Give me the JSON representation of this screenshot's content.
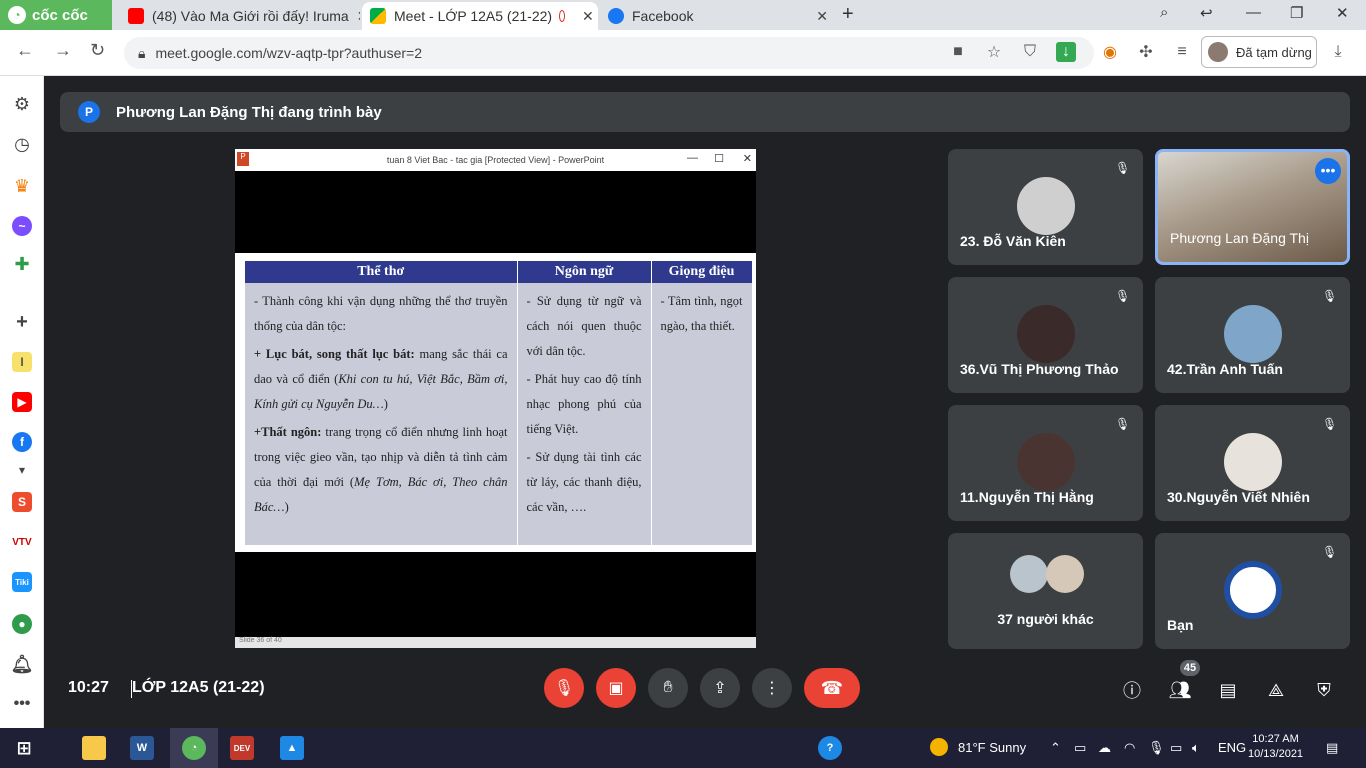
{
  "browser": {
    "brand": "cốc cốc",
    "tabs": [
      {
        "title": "(48) Vào Ma Giới rồi đấy! Iruma"
      },
      {
        "title": "Meet - LỚP 12A5 (21-22)"
      },
      {
        "title": "Facebook"
      }
    ],
    "url": "meet.google.com/wzv-aqtp-tpr?authuser=2",
    "profile_label": "Đã tạm dừng"
  },
  "meet": {
    "presenting_avatar": "P",
    "presenting_text": "Phương Lan Đặng Thị đang trình bày",
    "clock": "10:27",
    "meeting_title": "LỚP 12A5 (21-22)",
    "participant_count": "45",
    "participants": [
      {
        "name": "23. Đỗ Văn Kiên"
      },
      {
        "name": "Phương Lan Đặng Thị"
      },
      {
        "name": "36.Vũ Thị Phương Thảo"
      },
      {
        "name": "42.Trần Anh Tuấn"
      },
      {
        "name": "11.Nguyễn Thị Hằng"
      },
      {
        "name": "30.Nguyễn Viết Nhiên"
      },
      {
        "name": "37 người khác"
      },
      {
        "name": "Bạn"
      }
    ]
  },
  "ppt": {
    "window_title": "tuan 8 Viet Bac - tac gia [Protected View] - PowerPoint",
    "status": "Slide 36 of 40",
    "headers": [
      "Thể thơ",
      "Ngôn ngữ",
      "Giọng điệu"
    ],
    "col1": {
      "p1": "-  Thành công khi vận dụng những thể thơ truyền thống của dân tộc:",
      "p2_bold": "+ Lục bát, song thất lục bát:",
      "p2_text": " mang sắc thái ca dao và cổ điển (",
      "p2_italic": "Khi con tu hú, Việt Bắc, Bầm ơi, Kính gửi cụ Nguyễn Du…",
      "p2_end": ")",
      "p3_bold": "+Thất ngôn:",
      "p3_text": " trang trọng cổ điển nhưng linh hoạt trong việc gieo vần, tạo nhịp và diễn tả tình cảm của thời đại mới (",
      "p3_italic": "Mẹ Tơm, Bác ơi, Theo chân Bác…",
      "p3_end": ")"
    },
    "col2": {
      "p1": "-  Sử dụng từ ngữ và cách nói quen thuộc với dân tộc.",
      "p2": "-  Phát huy cao độ tính nhạc phong phú của tiếng Việt.",
      "p3": "-  Sử dụng tài tình các từ láy, các thanh điệu, các vần, …."
    },
    "col3": {
      "p1": "-  Tâm tình, ngọt ngào, tha thiết."
    }
  },
  "taskbar": {
    "weather": "81°F  Sunny",
    "lang": "ENG",
    "time": "10:27 AM",
    "date": "10/13/2021"
  }
}
